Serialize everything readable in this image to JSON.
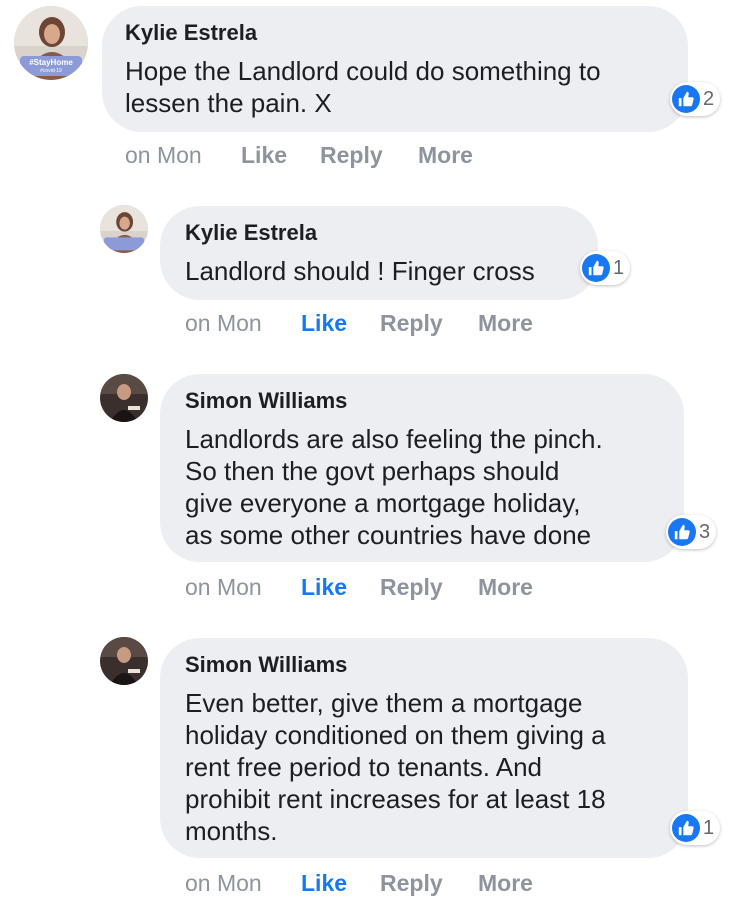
{
  "comments": [
    {
      "author": "Kylie Estrela",
      "lines": [
        "Hope the Landlord could do something to",
        "lessen the pain. X"
      ],
      "reaction_count": "2",
      "time": "on Mon",
      "like_label": "Like",
      "reply_label": "Reply",
      "more_label": "More",
      "avatar_badge": "#StayHome",
      "avatar_sub": "#covid-19"
    },
    {
      "author": "Kylie Estrela",
      "lines": [
        "Landlord should ! Finger cross"
      ],
      "reaction_count": "1",
      "time": "on Mon",
      "like_label": "Like",
      "reply_label": "Reply",
      "more_label": "More",
      "avatar_badge": "#StayHome",
      "avatar_sub": "#covid-19"
    },
    {
      "author": "Simon Williams",
      "lines": [
        "Landlords are also feeling the pinch.",
        "So then the govt perhaps should",
        "give everyone a mortgage holiday,",
        "as some other countries have done"
      ],
      "reaction_count": "3",
      "time": "on Mon",
      "like_label": "Like",
      "reply_label": "Reply",
      "more_label": "More"
    },
    {
      "author": "Simon Williams",
      "lines": [
        "Even better, give them a mortgage",
        "holiday conditioned on them giving a",
        "rent free period to tenants. And",
        "prohibit rent increases for at least 18",
        "months."
      ],
      "reaction_count": "1",
      "time": "on Mon",
      "like_label": "Like",
      "reply_label": "Reply",
      "more_label": "More"
    }
  ],
  "colors": {
    "bubble": "#edeef2",
    "like_active": "#1877f2",
    "muted": "#8d949e"
  }
}
